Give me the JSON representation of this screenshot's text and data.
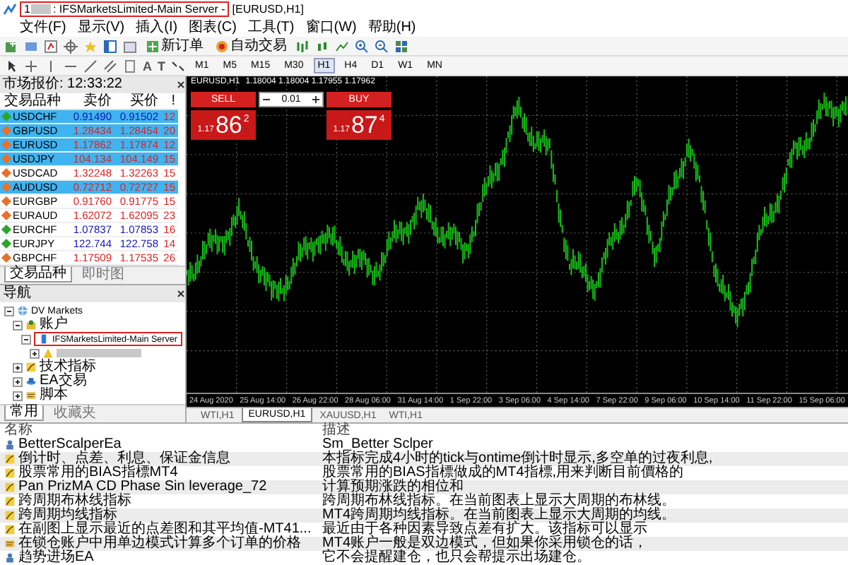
{
  "window": {
    "account_prefix": "1",
    "server_title": ": IFSMarketsLimited-Main Server -",
    "chart_title": "[EURUSD,H1]",
    "highlighted": true
  },
  "menu": [
    "文件(F)",
    "显示(V)",
    "插入(I)",
    "图表(C)",
    "工具(T)",
    "窗口(W)",
    "帮助(H)"
  ],
  "toolbar": {
    "buttons": [
      {
        "kind": "order",
        "label": "新订单"
      },
      {
        "kind": "auto",
        "label": "自动交易"
      }
    ],
    "text_tools": [
      "A",
      "T"
    ],
    "timeframes": [
      {
        "label": "M1",
        "selected": false
      },
      {
        "label": "M5",
        "selected": false
      },
      {
        "label": "M15",
        "selected": false
      },
      {
        "label": "M30",
        "selected": false
      },
      {
        "label": "H1",
        "selected": true
      },
      {
        "label": "H4",
        "selected": false
      },
      {
        "label": "D1",
        "selected": false
      },
      {
        "label": "W1",
        "selected": false
      },
      {
        "label": "MN",
        "selected": false
      }
    ]
  },
  "market_watch": {
    "title": "市场报价: 12:33:22",
    "columns": [
      "交易品种",
      "卖价",
      "买价",
      "!"
    ],
    "rows": [
      {
        "symbol": "USDCHF",
        "bid": "0.91490",
        "ask": "0.91502",
        "spread": "12",
        "rising": true,
        "selected": true
      },
      {
        "symbol": "GBPUSD",
        "bid": "1.28434",
        "ask": "1.28454",
        "spread": "20",
        "rising": false,
        "selected": true
      },
      {
        "symbol": "EURUSD",
        "bid": "1.17862",
        "ask": "1.17874",
        "spread": "12",
        "rising": false,
        "selected": true
      },
      {
        "symbol": "USDJPY",
        "bid": "104.134",
        "ask": "104.149",
        "spread": "15",
        "rising": false,
        "selected": true
      },
      {
        "symbol": "USDCAD",
        "bid": "1.32248",
        "ask": "1.32263",
        "spread": "15",
        "rising": false,
        "selected": false
      },
      {
        "symbol": "AUDUSD",
        "bid": "0.72712",
        "ask": "0.72727",
        "spread": "15",
        "rising": false,
        "selected": true
      },
      {
        "symbol": "EURGBP",
        "bid": "0.91760",
        "ask": "0.91775",
        "spread": "15",
        "rising": false,
        "selected": false
      },
      {
        "symbol": "EURAUD",
        "bid": "1.62072",
        "ask": "1.62095",
        "spread": "23",
        "rising": false,
        "selected": false
      },
      {
        "symbol": "EURCHF",
        "bid": "1.07837",
        "ask": "1.07853",
        "spread": "16",
        "rising": true,
        "selected": false
      },
      {
        "symbol": "EURJPY",
        "bid": "122.744",
        "ask": "122.758",
        "spread": "14",
        "rising": true,
        "selected": false
      },
      {
        "symbol": "GBPCHF",
        "bid": "1.17509",
        "ask": "1.17535",
        "spread": "26",
        "rising": false,
        "selected": false
      }
    ],
    "tabs": [
      {
        "label": "交易品种",
        "selected": true
      },
      {
        "label": "即时图",
        "selected": false
      }
    ]
  },
  "navigator": {
    "title": "导航",
    "tree": [
      {
        "kind": "broker",
        "label": "DV Markets",
        "expanded": true,
        "children": [
          {
            "kind": "accounts",
            "label": "账户",
            "expanded": true,
            "children": [
              {
                "kind": "server",
                "label": "IFSMarketsLimited-Main Server",
                "expanded": true,
                "highlighted": true,
                "children": [
                  {
                    "kind": "account",
                    "expanded": false
                  }
                ]
              }
            ]
          },
          {
            "kind": "indicators",
            "label": "技术指标",
            "expanded": false
          },
          {
            "kind": "experts",
            "label": "EA交易",
            "expanded": false
          },
          {
            "kind": "scripts",
            "label": "脚本",
            "expanded": false
          }
        ]
      }
    ],
    "tabs": [
      {
        "label": "常用",
        "selected": true
      },
      {
        "label": "收藏夹",
        "selected": false
      }
    ]
  },
  "chart": {
    "symbol": "EURUSD,H1",
    "ohlc": "1.18004 1.18004 1.17955 1.17962",
    "trade_panel": {
      "sell": "SELL",
      "buy": "BUY",
      "volume": "0.01",
      "sell_price": {
        "prefix": "1.17",
        "big": "86",
        "sup": "2"
      },
      "buy_price": {
        "prefix": "1.17",
        "big": "87",
        "sup": "4"
      }
    },
    "time_axis": [
      "24 Aug 2020",
      "25 Aug 14:00",
      "26 Aug 22:00",
      "28 Aug 06:00",
      "31 Aug 14:00",
      "1 Sep 22:00",
      "3 Sep 06:00",
      "4 Sep 14:00",
      "7 Sep 22:00",
      "9 Sep 06:00",
      "10 Sep 14:00",
      "11 Sep 22:00",
      "15 Sep 06:00"
    ],
    "tabs": [
      {
        "label": "WTI,H1",
        "selected": false
      },
      {
        "label": "EURUSD,H1",
        "selected": true
      },
      {
        "label": "XAUUSD,H1",
        "selected": false
      },
      {
        "label": "WTI,H1",
        "selected": false
      }
    ]
  },
  "market_table": {
    "columns": [
      "名称",
      "描述"
    ],
    "rows": [
      {
        "kind": "expert",
        "name": "BetterScalperEa",
        "description": "Sm_Better  Sclper"
      },
      {
        "kind": "indicator",
        "name": "倒计时、点差、利息、保证金信息",
        "description": "本指标完成4小时的tick与ontime倒计时显示,多空单的过夜利息,"
      },
      {
        "kind": "indicator",
        "name": "股票常用的BIAS指標MT4",
        "description": "股票常用的BIAS指標做成的MT4指標,用来判断目前價格的"
      },
      {
        "kind": "indicator",
        "name": "Pan PrizMA CD Phase Sin leverage_72",
        "description": "计算预期涨跌的相位和"
      },
      {
        "kind": "indicator",
        "name": "跨周期布林线指标",
        "description": "跨周期布林线指标。在当前图表上显示大周期的布林线。"
      },
      {
        "kind": "indicator",
        "name": "跨周期均线指标",
        "description": "MT4跨周期均线指标。在当前图表上显示大周期的均线。"
      },
      {
        "kind": "indicator",
        "name": "在副图上显示最近的点差图和其平均值-MT41...",
        "description": "最近由于各种因素导致点差有扩大。该指标可以显示"
      },
      {
        "kind": "script",
        "name": "在锁仓账户中用单边模式计算多个订单的价格",
        "description": "MT4账户一般是双边模式，但如果你采用锁仓的话，"
      },
      {
        "kind": "expert",
        "name": "趋势进场EA",
        "description": "它不会提醒建仓，也只会帮提示出场建仓。"
      }
    ]
  }
}
